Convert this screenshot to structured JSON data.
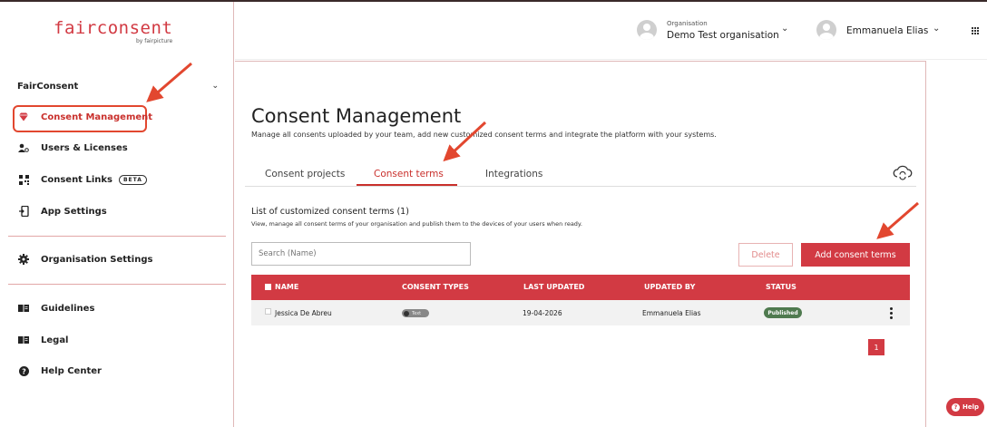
{
  "logo": {
    "text": "fairconsent",
    "sub": "by fairpicture"
  },
  "sidebar": {
    "section": "FairConsent",
    "items": [
      {
        "label": "Consent Management",
        "icon": "diamond-icon"
      },
      {
        "label": "Users & Licenses",
        "icon": "users-icon"
      },
      {
        "label": "Consent Links",
        "icon": "qr-icon",
        "badge": "BETA"
      },
      {
        "label": "App Settings",
        "icon": "app-icon"
      },
      {
        "label": "Organisation Settings",
        "icon": "gear-icon"
      },
      {
        "label": "Guidelines",
        "icon": "book-icon"
      },
      {
        "label": "Legal",
        "icon": "book-icon"
      },
      {
        "label": "Help Center",
        "icon": "help-icon"
      }
    ]
  },
  "header": {
    "org_label": "Organisation",
    "org_name": "Demo Test organisation",
    "user_name": "Emmanuela Elias"
  },
  "main": {
    "title": "Consent Management",
    "subtitle": "Manage all consents uploaded by your team, add new customized consent terms and integrate the platform with your systems.",
    "tabs": [
      {
        "label": "Consent projects"
      },
      {
        "label": "Consent terms",
        "active": true
      },
      {
        "label": "Integrations"
      }
    ],
    "list_title": "List of customized consent terms (1)",
    "list_sub": "View, manage all consent terms of your organisation and publish them to the devices of your users when ready.",
    "search_placeholder": "Search (Name)",
    "delete_label": "Delete",
    "add_label": "Add consent terms",
    "table": {
      "headers": [
        "NAME",
        "CONSENT TYPES",
        "LAST UPDATED",
        "UPDATED BY",
        "STATUS"
      ],
      "rows": [
        {
          "name": "Jessica De Abreu",
          "type": "Text",
          "last_updated": "19-04-2026",
          "updated_by": "Emmanuela Elias",
          "status": "Published"
        }
      ]
    },
    "page": "1"
  },
  "help_label": "Help",
  "colors": {
    "accent": "#d23a43",
    "annotation": "#e2472f",
    "published": "#4f7a4f"
  }
}
